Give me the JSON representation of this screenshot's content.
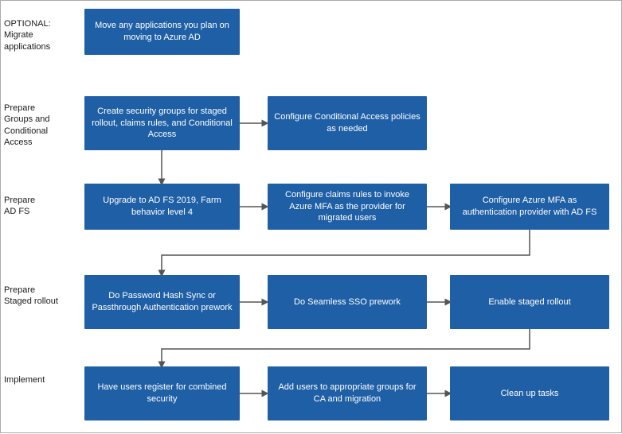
{
  "labels": {
    "optional": "OPTIONAL:\nMigrate\napplications",
    "prepareGroups": "Prepare\nGroups and\nConditional\nAccess",
    "prepareADFS": "Prepare\nAD FS",
    "prepareStagedRollout": "Prepare\nStaged rollout",
    "implement": "Implement"
  },
  "boxes": {
    "box1": "Move any applications you plan on moving to Azure AD",
    "box2": "Create security groups for staged rollout, claims rules, and Conditional Access",
    "box3": "Configure Conditional Access policies as needed",
    "box4": "Upgrade to AD FS 2019, Farm behavior level 4",
    "box5": "Configure claims rules to invoke Azure MFA as the provider for migrated users",
    "box6": "Configure Azure MFA as authentication provider with AD FS",
    "box7": "Do Password Hash Sync or Passthrough Authentication prework",
    "box8": "Do Seamless SSO prework",
    "box9": "Enable staged rollout",
    "box10": "Have users register for combined security",
    "box11": "Add users to appropriate groups for CA and migration",
    "box12": "Clean up tasks"
  }
}
